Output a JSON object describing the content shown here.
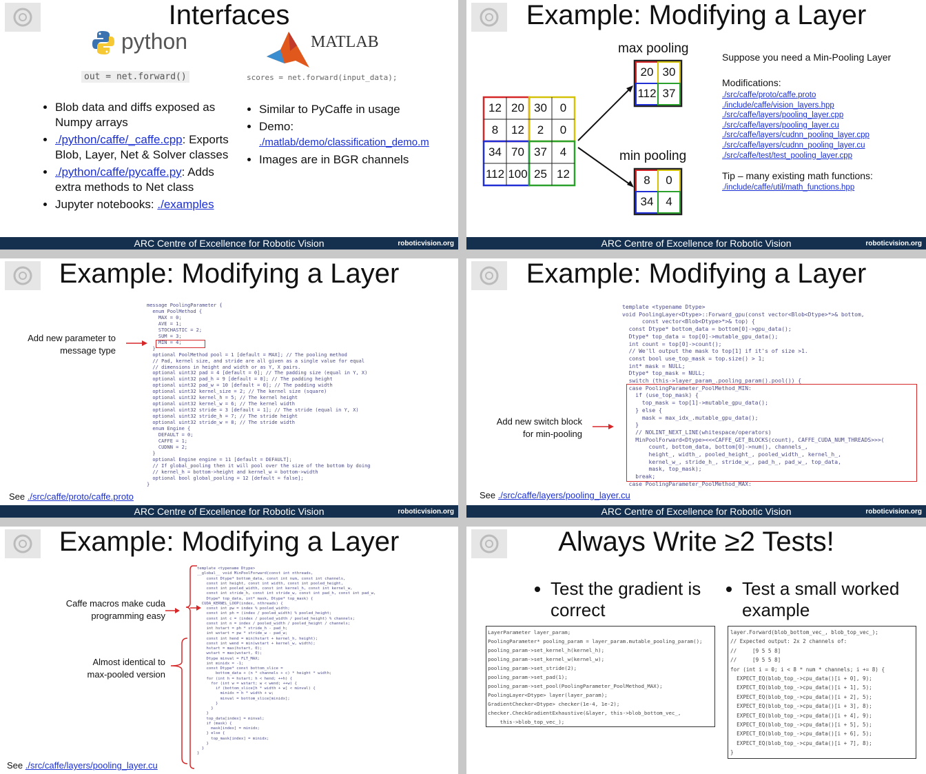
{
  "footer": {
    "center": "ARC Centre of Excellence for Robotic Vision",
    "site": "roboticvision.org"
  },
  "s1": {
    "title": "Interfaces",
    "python_logo": "python",
    "matlab_logo": "MATLAB",
    "py_code": "out = net.forward()",
    "mat_code": "scores = net.forward(input_data);",
    "left": {
      "b1": "Blob data and diffs exposed as Numpy arrays",
      "b2_link": "./python/caffe/_caffe.cpp",
      "b2_rest": ": Exports Blob, Layer, Net & Solver classes",
      "b3_link": "./python/caffe/pycaffe.py",
      "b3_rest": ": Adds extra methods to Net class",
      "b4_text": "Jupyter notebooks: ",
      "b4_link": "./examples"
    },
    "right": {
      "b1": "Similar to PyCaffe in usage",
      "b2_text": "Demo:",
      "b2_link": "./matlab/demo/classification_demo.m",
      "b3": "Images are in BGR channels"
    }
  },
  "s2": {
    "title": "Example: Modifying a Layer",
    "max_label": "max pooling",
    "min_label": "min pooling",
    "input_grid": [
      "12",
      "20",
      "30",
      "0",
      "8",
      "12",
      "2",
      "0",
      "34",
      "70",
      "37",
      "4",
      "112",
      "100",
      "25",
      "12"
    ],
    "max_grid": [
      "20",
      "30",
      "112",
      "37"
    ],
    "min_grid": [
      "8",
      "0",
      "34",
      "4"
    ],
    "suppose": "Suppose you need a Min-Pooling Layer",
    "mods_heading": "Modifications:",
    "mods": [
      "./src/caffe/proto/caffe.proto",
      "./include/caffe/vision_layers.hpp",
      "./src/caffe/layers/pooling_layer.cpp",
      "./src/caffe/layers/pooling_layer.cu",
      "./src/caffe/layers/cudnn_pooling_layer.cpp",
      "./src/caffe/layers/cudnn_pooling_layer.cu",
      "./src/caffe/test/test_pooling_layer.cpp"
    ],
    "tip": "Tip – many existing math functions:",
    "tip_link": "./include/caffe/util/math_functions.hpp"
  },
  "s3": {
    "title": "Example: Modifying a Layer",
    "note": "Add new parameter to\nmessage type",
    "see_text": "See ",
    "see_link": "./src/caffe/proto/caffe.proto",
    "code": [
      "message PoolingParameter {",
      "  enum PoolMethod {",
      "    MAX = 0;",
      "    AVE = 1;",
      "    STOCHASTIC = 2;",
      "    SUM = 3;",
      "    MIN = 4;",
      "  }",
      "  optional PoolMethod pool = 1 [default = MAX]; // The pooling method",
      "  // Pad, kernel size, and stride are all given as a single value for equal",
      "  // dimensions in height and width or as Y, X pairs.",
      "  optional uint32 pad = 4 [default = 0]; // The padding size (equal in Y, X)",
      "  optional uint32 pad_h = 9 [default = 0]; // The padding height",
      "  optional uint32 pad_w = 10 [default = 0]; // The padding width",
      "  optional uint32 kernel_size = 2; // The kernel size (square)",
      "  optional uint32 kernel_h = 5; // The kernel height",
      "  optional uint32 kernel_w = 6; // The kernel width",
      "  optional uint32 stride = 3 [default = 1]; // The stride (equal in Y, X)",
      "  optional uint32 stride_h = 7; // The stride height",
      "  optional uint32 stride_w = 8; // The stride width",
      "  enum Engine {",
      "    DEFAULT = 0;",
      "    CAFFE = 1;",
      "    CUDNN = 2;",
      "  }",
      "  optional Engine engine = 11 [default = DEFAULT];",
      "  // If global_pooling then it will pool over the size of the bottom by doing",
      "  // kernel_h = bottom->height and kernel_w = bottom->width",
      "  optional bool global_pooling = 12 [default = false];",
      "}"
    ]
  },
  "s4": {
    "title": "Example: Modifying a Layer",
    "note": "Add new switch block\nfor min-pooling",
    "see_text": "See ",
    "see_link": "./src/caffe/layers/pooling_layer.cu",
    "code": [
      "template <typename Dtype>",
      "void PoolingLayer<Dtype>::Forward_gpu(const vector<Blob<Dtype>*>& bottom,",
      "      const vector<Blob<Dtype>*>& top) {",
      "  const Dtype* bottom_data = bottom[0]->gpu_data();",
      "  Dtype* top_data = top[0]->mutable_gpu_data();",
      "  int count = top[0]->count();",
      "  // We'll output the mask to top[1] if it's of size >1.",
      "  const bool use_top_mask = top.size() > 1;",
      "  int* mask = NULL;",
      "  Dtype* top_mask = NULL;",
      "  switch (this->layer_param_.pooling_param().pool()) {",
      "  case PoolingParameter_PoolMethod_MIN:",
      "    if (use_top_mask) {",
      "      top_mask = top[1]->mutable_gpu_data();",
      "    } else {",
      "      mask = max_idx_.mutable_gpu_data();",
      "    }",
      "    // NOLINT_NEXT_LINE(whitespace/operators)",
      "    MinPoolForward<Dtype><<<CAFFE_GET_BLOCKS(count), CAFFE_CUDA_NUM_THREADS>>>(",
      "        count, bottom_data, bottom[0]->num(), channels_,",
      "        height_, width_, pooled_height_, pooled_width_, kernel_h_,",
      "        kernel_w_, stride_h_, stride_w_, pad_h_, pad_w_, top_data,",
      "        mask, top_mask);",
      "    break;",
      "  case PoolingParameter_PoolMethod_MAX:"
    ]
  },
  "s5": {
    "title": "Example: Modifying a Layer",
    "note1": "Caffe macros make cuda\nprogramming easy",
    "note2": "Almost identical to\nmax-pooled version",
    "see_text": "See ",
    "see_link": "./src/caffe/layers/pooling_layer.cu",
    "code": [
      "template <typename Dtype>",
      "__global__ void MinPoolForward(const int nthreads,",
      "    const Dtype* bottom_data, const int num, const int channels,",
      "    const int height, const int width, const int pooled_height,",
      "    const int pooled_width, const int kernel_h, const int kernel_w,",
      "    const int stride_h, const int stride_w, const int pad_h, const int pad_w,",
      "    Dtype* top_data, int* mask, Dtype* top_mask) {",
      "  CUDA_KERNEL_LOOP(index, nthreads) {",
      "    const int pw = index % pooled_width;",
      "    const int ph = (index / pooled_width) % pooled_height;",
      "    const int c = (index / pooled_width / pooled_height) % channels;",
      "    const int n = index / pooled_width / pooled_height / channels;",
      "    int hstart = ph * stride_h - pad_h;",
      "    int wstart = pw * stride_w - pad_w;",
      "    const int hend = min(hstart + kernel_h, height);",
      "    const int wend = min(wstart + kernel_w, width);",
      "    hstart = max(hstart, 0);",
      "    wstart = max(wstart, 0);",
      "    Dtype minval = FLT_MAX;",
      "    int minidx = -1;",
      "    const Dtype* const bottom_slice =",
      "        bottom_data + (n * channels + c) * height * width;",
      "    for (int h = hstart; h < hend; ++h) {",
      "      for (int w = wstart; w < wend; ++w) {",
      "        if (bottom_slice[h * width + w] < minval) {",
      "          minidx = h * width + w;",
      "          minval = bottom_slice[minidx];",
      "        }",
      "      }",
      "    }",
      "    top_data[index] = minval;",
      "    if (mask) {",
      "      mask[index] = minidx;",
      "    } else {",
      "      top_mask[index] = minidx;",
      "    }",
      "  }",
      "}"
    ]
  },
  "s6": {
    "title": "Always Write ≥2 Tests!",
    "b1": "Test the gradient is correct",
    "b2": "Test a small worked example",
    "code_left": [
      "LayerParameter layer_param;",
      "PoolingParameter* pooling_param = layer_param.mutable_pooling_param();",
      "pooling_param->set_kernel_h(kernel_h);",
      "pooling_param->set_kernel_w(kernel_w);",
      "pooling_param->set_stride(2);",
      "pooling_param->set_pad(1);",
      "pooling_param->set_pool(PoolingParameter_PoolMethod_MAX);",
      "PoolingLayer<Dtype> layer(layer_param);",
      "GradientChecker<Dtype> checker(1e-4, 1e-2);",
      "checker.CheckGradientExhaustive(&layer, this->blob_bottom_vec_,",
      "    this->blob_top_vec_);"
    ],
    "code_right": [
      "layer.Forward(blob_bottom_vec_, blob_top_vec_);",
      "// Expected output: 2x 2 channels of:",
      "//     [9 5 5 8]",
      "//     [9 5 5 8]",
      "for (int i = 0; i < 8 * num * channels; i += 8) {",
      "  EXPECT_EQ(blob_top_->cpu_data()[i + 0], 9);",
      "  EXPECT_EQ(blob_top_->cpu_data()[i + 1], 5);",
      "  EXPECT_EQ(blob_top_->cpu_data()[i + 2], 5);",
      "  EXPECT_EQ(blob_top_->cpu_data()[i + 3], 8);",
      "  EXPECT_EQ(blob_top_->cpu_data()[i + 4], 9);",
      "  EXPECT_EQ(blob_top_->cpu_data()[i + 5], 5);",
      "  EXPECT_EQ(blob_top_->cpu_data()[i + 6], 5);",
      "  EXPECT_EQ(blob_top_->cpu_data()[i + 7], 8);",
      "}"
    ]
  }
}
